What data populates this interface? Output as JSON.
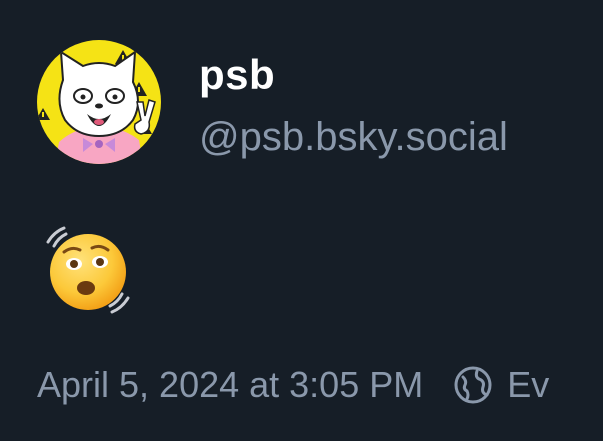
{
  "post": {
    "author": {
      "display_name": "psb",
      "handle": "@psb.bsky.social"
    },
    "body": {
      "emoji": "😲"
    },
    "timestamp": "April 5, 2024 at 3:05 PM",
    "audience": "Ev"
  },
  "colors": {
    "background": "#161e27",
    "display_name": "#ffffff",
    "secondary_text": "#8a98ab",
    "avatar_background": "#f5e315"
  },
  "icons": {
    "audience": "globe-icon"
  }
}
